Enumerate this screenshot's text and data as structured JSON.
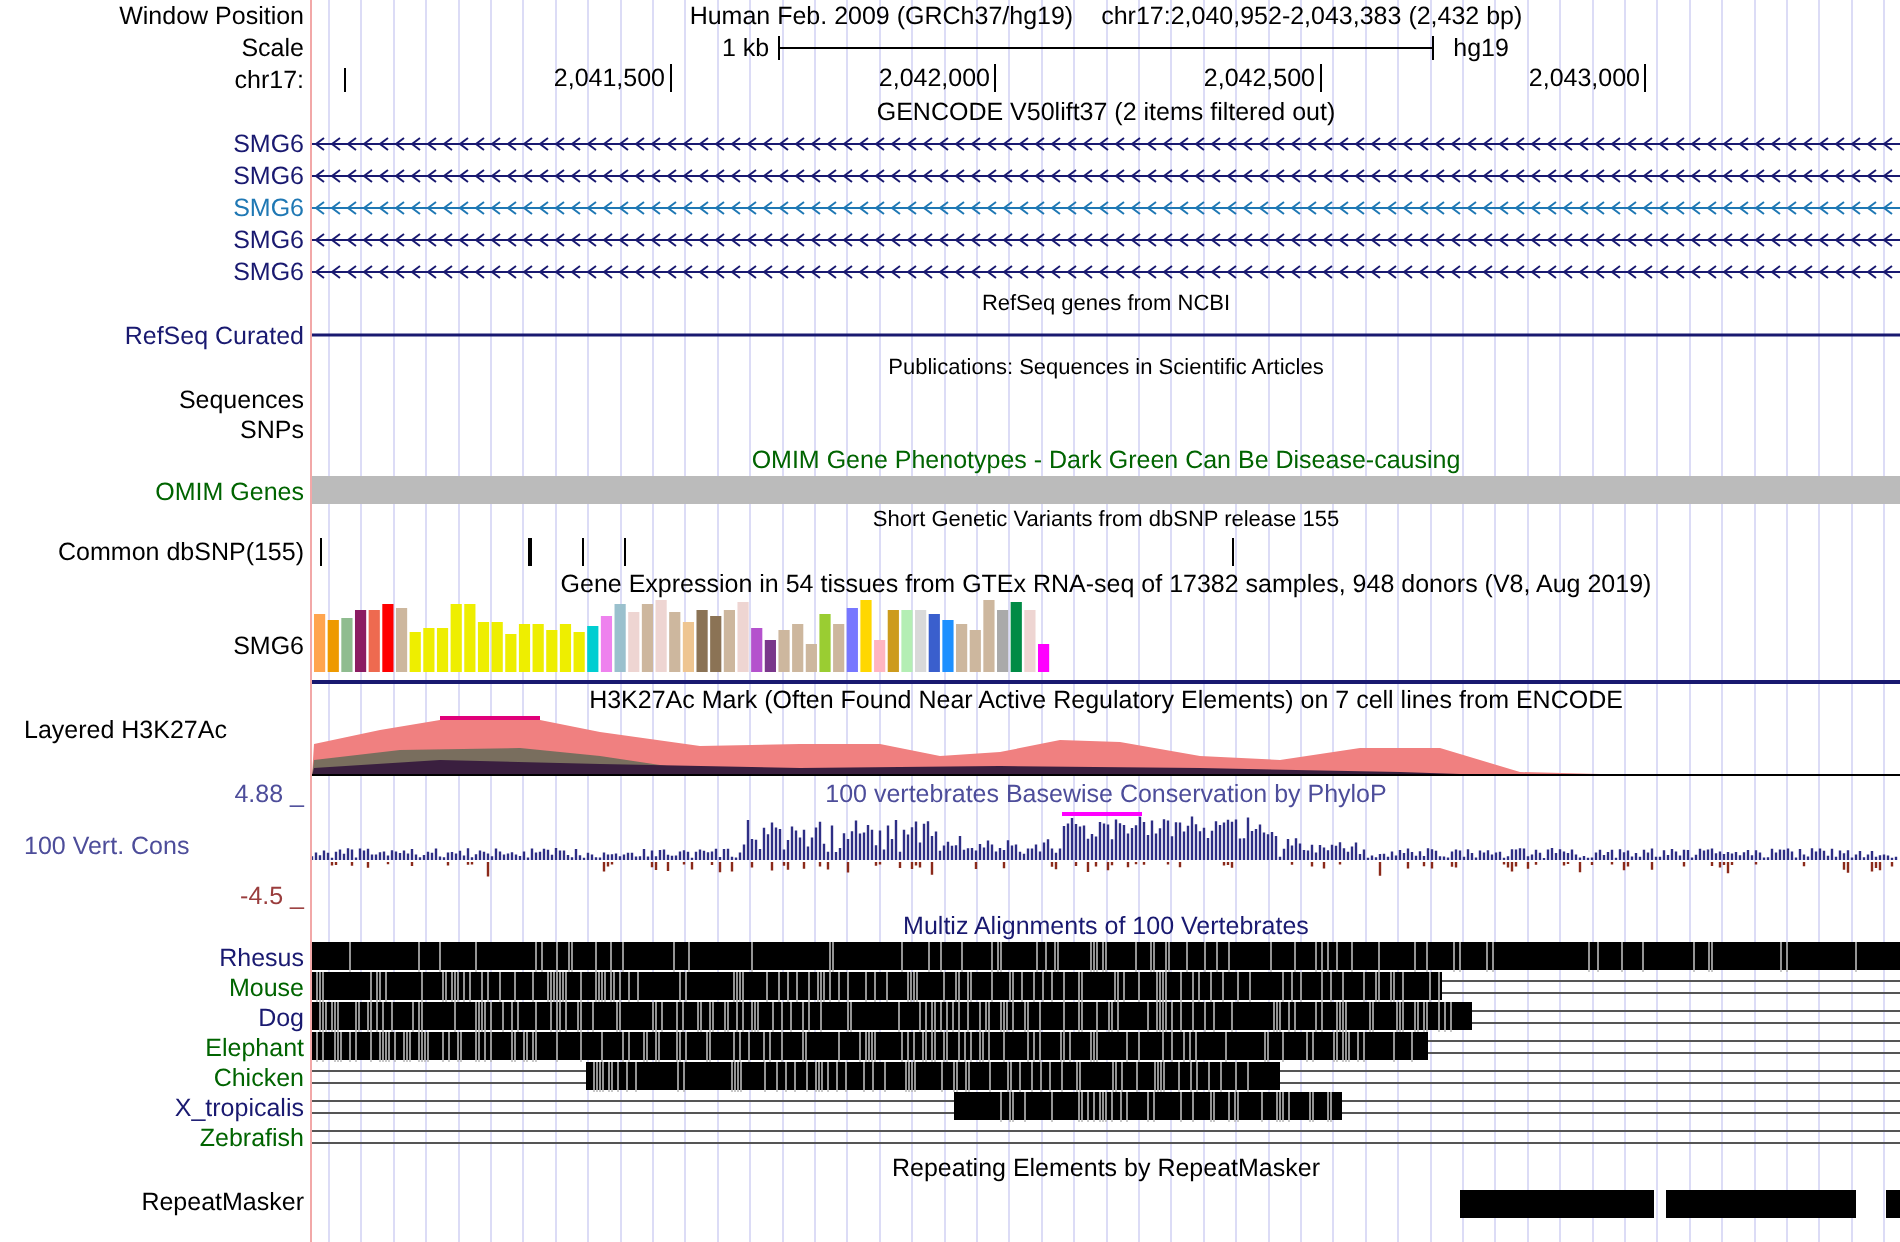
{
  "header": {
    "label": "Window Position",
    "title": "Human Feb. 2009 (GRCh37/hg19)",
    "position": "chr17:2,040,952-2,043,383 (2,432 bp)"
  },
  "scale": {
    "label": "Scale",
    "length": "1 kb",
    "assembly": "hg19"
  },
  "ruler": {
    "label": "chr17:",
    "ticks": [
      "2,041,500",
      "2,042,000",
      "2,042,500",
      "2,043,000"
    ]
  },
  "tracks": [
    {
      "kind": "title",
      "text": "GENCODE V50lift37 (2 items filtered out)",
      "color": "#000000"
    },
    {
      "kind": "gene",
      "label": "SMG6",
      "color": "#191970"
    },
    {
      "kind": "gene",
      "label": "SMG6",
      "color": "#191970"
    },
    {
      "kind": "gene",
      "label": "SMG6",
      "color": "#1f78b4"
    },
    {
      "kind": "gene",
      "label": "SMG6",
      "color": "#191970"
    },
    {
      "kind": "gene",
      "label": "SMG6",
      "color": "#191970"
    },
    {
      "kind": "note",
      "text": "RefSeq genes from NCBI"
    },
    {
      "kind": "line",
      "label": "RefSeq Curated",
      "color": "#191970"
    },
    {
      "kind": "note",
      "text": "Publications: Sequences in Scientific Articles"
    },
    {
      "kind": "blank",
      "label": "Sequences",
      "color": "#000000"
    },
    {
      "kind": "blank",
      "label": "SNPs",
      "color": "#000000"
    },
    {
      "kind": "title",
      "text": "OMIM Gene Phenotypes - Dark Green Can Be Disease-causing",
      "color": "#006400"
    },
    {
      "kind": "bar",
      "label": "OMIM Genes",
      "color": "#006400"
    },
    {
      "kind": "note",
      "text": "Short Genetic Variants from dbSNP release 155"
    },
    {
      "kind": "ticks",
      "label": "Common dbSNP(155)",
      "color": "#000000"
    },
    {
      "kind": "title",
      "text": "Gene Expression in 54 tissues from GTEx RNA-seq of 17382 samples, 948 donors (V8, Aug 2019)",
      "color": "#000000"
    },
    {
      "kind": "expression",
      "label": "SMG6",
      "color": "#000000"
    },
    {
      "kind": "layered",
      "label": "Layered H3K27Ac",
      "text": "H3K27Ac Mark (Often Found Near Active Regulatory Elements) on 7 cell lines from ENCODE"
    },
    {
      "kind": "wiggle",
      "label": "100 Vert. Cons",
      "max": "4.88 _",
      "min": "-4.5 _",
      "text": "100 vertebrates Basewise Conservation by PhyloP"
    },
    {
      "kind": "title",
      "text": "Multiz Alignments of 100 Vertebrates",
      "color": "#191970"
    },
    {
      "kind": "alignment",
      "label": "Rhesus",
      "color": "#191970"
    },
    {
      "kind": "alignment",
      "label": "Mouse",
      "color": "#006400"
    },
    {
      "kind": "alignment",
      "label": "Dog",
      "color": "#191970"
    },
    {
      "kind": "alignment",
      "label": "Elephant",
      "color": "#006400"
    },
    {
      "kind": "alignment",
      "label": "Chicken",
      "color": "#006400"
    },
    {
      "kind": "alignment",
      "label": "X_tropicalis",
      "color": "#191970"
    },
    {
      "kind": "alignment",
      "label": "Zebrafish",
      "color": "#006400"
    },
    {
      "kind": "title",
      "text": "Repeating Elements by RepeatMasker",
      "color": "#000000"
    },
    {
      "kind": "repeat",
      "label": "RepeatMasker",
      "color": "#000000"
    }
  ]
}
